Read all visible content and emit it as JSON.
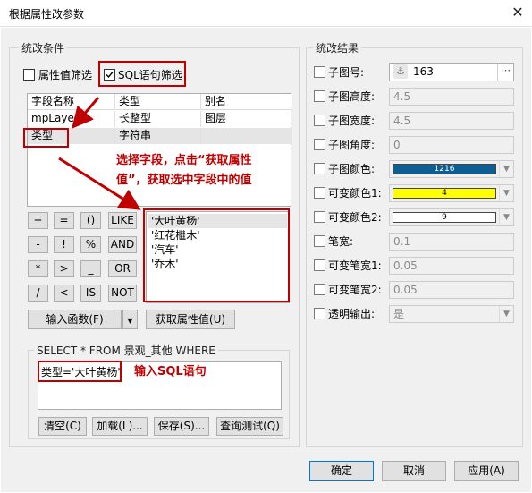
{
  "window": {
    "title": "根据属性改参数",
    "close_glyph": "✕"
  },
  "left_group": {
    "label": "统改条件",
    "filter_attr_label": "属性值筛选",
    "filter_sql_label": "SQL语句筛选",
    "columns": [
      "字段名称",
      "类型",
      "别名"
    ],
    "rows": [
      [
        "mpLayer",
        "长整型",
        "图层"
      ],
      [
        "类型",
        "字符串",
        ""
      ]
    ],
    "annotation_select": "选择字段，点击“获取属性值”，获取选中字段中的值",
    "annotation_select_line1": "选择字段，点击“获取属性",
    "annotation_select_line2": "值”，获取选中字段中的值",
    "operators_row1": [
      "+",
      "=",
      "()",
      "LIKE"
    ],
    "operators_row2": [
      "-",
      "!",
      "%",
      "AND"
    ],
    "operators_row3": [
      "*",
      ">",
      "_",
      "OR"
    ],
    "operators_row4": [
      "/",
      "<",
      "IS",
      "NOT"
    ],
    "values": [
      "'大叶黄杨'",
      "'红花檵木'",
      "'汽车'",
      "'乔木'"
    ],
    "input_func_label": "输入函数(F)",
    "get_values_label": "获取属性值(U)",
    "sql_group_label": "SELECT * FROM 景观_其他 WHERE",
    "sql_text": "类型='大叶黄杨'",
    "annotation_sql": "输入SQL语句",
    "btn_clear": "清空(C)",
    "btn_load": "加载(L)...",
    "btn_save": "保存(S)...",
    "btn_test": "查询测试(Q)"
  },
  "right_group": {
    "label": "统改结果",
    "rows": [
      {
        "label": "子图号:",
        "value": "163",
        "icon": "anchor-icon"
      },
      {
        "label": "子图高度:",
        "value": "4.5"
      },
      {
        "label": "子图宽度:",
        "value": "4.5"
      },
      {
        "label": "子图角度:",
        "value": "0"
      },
      {
        "label": "子图颜色:",
        "value": "1216",
        "color": "#0d5f93"
      },
      {
        "label": "可变颜色1:",
        "value": "4",
        "color": "#ffff00"
      },
      {
        "label": "可变颜色2:",
        "value": "9",
        "color": "#ffffff"
      },
      {
        "label": "笔宽:",
        "value": "0.1"
      },
      {
        "label": "可变笔宽1:",
        "value": "0.05"
      },
      {
        "label": "可变笔宽2:",
        "value": "0.05"
      },
      {
        "label": "透明输出:",
        "value": "是"
      }
    ],
    "ellipsis": "···"
  },
  "footer": {
    "ok": "确定",
    "cancel": "取消",
    "apply": "应用(A)"
  }
}
